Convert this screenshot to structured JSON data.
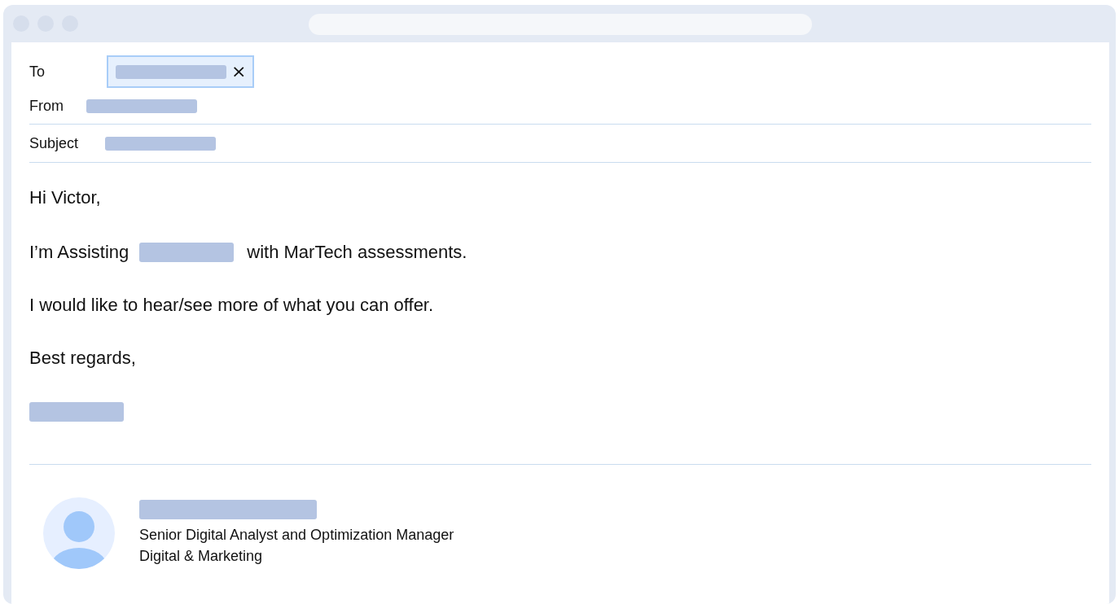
{
  "header_fields": [
    {
      "label": "To",
      "kind": "chip",
      "remove": "×"
    },
    {
      "label": "From",
      "kind": "plain"
    },
    {
      "label": "Subject",
      "kind": "plain"
    }
  ],
  "greeting": "Hi Victor,",
  "paragraphs": [
    {
      "segments": [
        {
          "kind": "text",
          "text": "I’m Assisting"
        },
        {
          "kind": "redaction"
        },
        {
          "kind": "text",
          "text": "with MarTech assessments."
        }
      ]
    },
    {
      "segments": [
        {
          "kind": "text",
          "text": "I would like to hear/see more of what you can offer."
        }
      ]
    }
  ],
  "closing": "Best regards,",
  "signature": {
    "title": "Senior Digital Analyst and Optimization Manager",
    "department": "Digital & Marketing"
  }
}
